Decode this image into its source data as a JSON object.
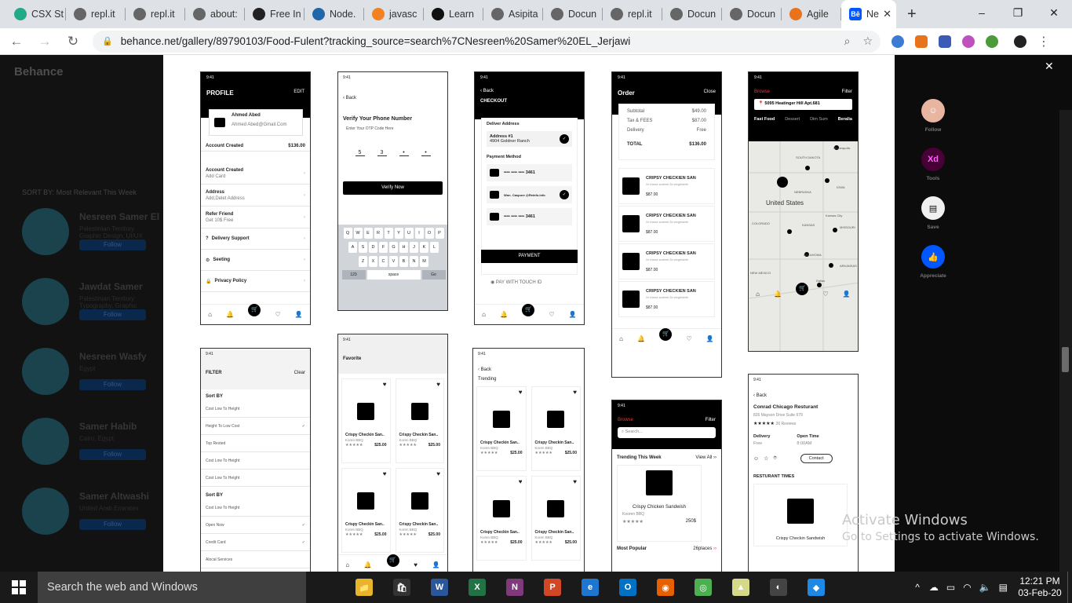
{
  "browser": {
    "tabs": [
      {
        "label": "CSX St",
        "icon": "csx-icon",
        "color": "#22aa88"
      },
      {
        "label": "repl.it",
        "icon": "repl-icon",
        "color": "#666666"
      },
      {
        "label": "repl.it",
        "icon": "repl-icon",
        "color": "#666666"
      },
      {
        "label": "about:",
        "icon": "globe-icon",
        "color": "#666666"
      },
      {
        "label": "Free In",
        "icon": "braces-icon",
        "color": "#222222"
      },
      {
        "label": "Node.",
        "icon": "node-icon",
        "color": "#2266aa"
      },
      {
        "label": "javasc",
        "icon": "stackoverflow-icon",
        "color": "#f48024"
      },
      {
        "label": "Learn",
        "icon": "learn-icon",
        "color": "#111111"
      },
      {
        "label": "Asipita",
        "icon": "globe-icon",
        "color": "#666666"
      },
      {
        "label": "Docun",
        "icon": "globe-icon",
        "color": "#666666"
      },
      {
        "label": "repl.it",
        "icon": "repl-icon",
        "color": "#666666"
      },
      {
        "label": "Docun",
        "icon": "globe-icon",
        "color": "#666666"
      },
      {
        "label": "Docun",
        "icon": "globe-icon",
        "color": "#666666"
      },
      {
        "label": "Agile",
        "icon": "agile-icon",
        "color": "#e8731a"
      }
    ],
    "active_tab": {
      "label": "Ne",
      "icon_text": "Bē"
    },
    "new_tab": "+",
    "window_controls": {
      "minimize": "–",
      "maximize": "❐",
      "close": "✕"
    },
    "url": "behance.net/gallery/89790103/Food-Fulent?tracking_source=search%7CNesreen%20Samer%20EL_Jerjawi"
  },
  "behance": {
    "logo": "Behance",
    "sort_label": "SORT BY:  Most Relevant This Week",
    "profiles": [
      {
        "name": "Nesreen Samer El",
        "sub": "Palestinian Territory\nGraphic Design, UI/UX",
        "follow": "Follow"
      },
      {
        "name": "Jawdat Samer",
        "sub": "Palestinian Territory\nTypography, Graphic Design",
        "follow": "Follow"
      },
      {
        "name": "Nesreen Wasfy",
        "sub": "Egypt",
        "follow": "Follow"
      },
      {
        "name": "Samer Habib",
        "sub": "Cairo, Egypt",
        "follow": "Follow"
      },
      {
        "name": "Samer Altwashi",
        "sub": "United Arab Emirates",
        "follow": "Follow"
      }
    ],
    "side_actions": [
      {
        "label": "Follow",
        "icon": "avatar-icon"
      },
      {
        "label": "Tools",
        "icon": "xd-icon"
      },
      {
        "label": "Save",
        "icon": "save-icon"
      },
      {
        "label": "Appreciate",
        "icon": "thumbs-up-icon"
      }
    ]
  },
  "screens": {
    "status_time": "9:41",
    "profile": {
      "title": "PROFILE",
      "edit": "EDIT",
      "name": "Ahmed Abed",
      "email": "Ahmed Abed@Gmail.Com",
      "account_created": "Account Created",
      "amount": "$136.00",
      "rows": [
        {
          "t": "Account Created",
          "s": "Add Card"
        },
        {
          "t": "Address",
          "s": "Add,Delet Address"
        },
        {
          "t": "Refer Friend",
          "s": "Get 10$ Free"
        },
        {
          "t": "Delivery Support",
          "s": ""
        },
        {
          "t": "Seeting",
          "s": ""
        },
        {
          "t": "Privacy Policy",
          "s": ""
        }
      ]
    },
    "verify": {
      "back": "Back",
      "title": "Verify Your Phone Number",
      "sub": "Enter Your OTP Code Here",
      "digits": [
        "5",
        "3",
        "•",
        "•"
      ],
      "button": "Verify Now",
      "keys1": [
        "Q",
        "W",
        "E",
        "R",
        "T",
        "Y",
        "U",
        "I",
        "O",
        "P"
      ],
      "keys2": [
        "A",
        "S",
        "D",
        "F",
        "G",
        "H",
        "J",
        "K",
        "L"
      ],
      "keys3": [
        "Z",
        "X",
        "C",
        "V",
        "B",
        "N",
        "M"
      ],
      "k123": "123",
      "space": "space",
      "go": "Go"
    },
    "checkout": {
      "back": "Back",
      "title": "CHECKOUT",
      "deliver": "Deliver Address",
      "address_label": "Address #1",
      "address": "4904 Goldner Ranch",
      "payment": "Payment Method",
      "cards": [
        "•••• •••• •••• 3461",
        "Won. Caspure @Reinfo.info",
        "•••• •••• •••• 3461"
      ],
      "button": "PAYMENT",
      "touch": "PAY WITH TOUCH ID"
    },
    "order": {
      "title": "Order",
      "close": "Close",
      "lines": [
        [
          "Subtotal",
          "$49.00"
        ],
        [
          "Tax & FEES",
          "$87.00"
        ],
        [
          "Delivery",
          "Free"
        ]
      ],
      "total_label": "TOTAL",
      "total": "$136.00",
      "items": [
        {
          "name": "CRIPSY CHECKIEN SAN",
          "desc": "2x thana scahmi,3x wegetable.",
          "price": "$87.00"
        },
        {
          "name": "CRIPSY CHECKIEN SAN",
          "desc": "2x thana scahmi,3x wegetable.",
          "price": "$87.00"
        },
        {
          "name": "CRIPSY CHECKIEN SAN",
          "desc": "2x thana scahmi,3x wegetable.",
          "price": "$87.00"
        },
        {
          "name": "CRIPSY CHECKIEN SAN",
          "desc": "2x thana scahmi,3x wegetable.",
          "price": "$87.00"
        }
      ]
    },
    "map": {
      "browse": "Browse",
      "filter": "Filter",
      "address": "5095 Heatinger Hill Apt.681",
      "tabs": [
        "Fast Food",
        "Dessert",
        "Dim Sum",
        "Beralia"
      ],
      "labels": [
        "SOUTH DAKOTA",
        "NEBRASKA",
        "IOWA",
        "United States",
        "KANSAS",
        "COLORADO",
        "Kansas City",
        "MISSOURI",
        "OKLAHOMA",
        "ARKANSAS",
        "NEW MEXICO",
        "Dallas",
        "Minneapolis"
      ]
    },
    "filter": {
      "title": "FILTER",
      "clear": "Clear",
      "sort1": "Sort BY",
      "opts1": [
        "Cost Low To Height",
        "Height To Low Cost",
        "Top Rested",
        "Cost Low To Height",
        "Cost Low To Height"
      ],
      "sort2": "Sort BY",
      "opts2": [
        "Cost Low To Height",
        "Open Now",
        "Credit Card",
        "Alocal Services"
      ]
    },
    "favorite": {
      "title": "Favorite",
      "item_name": "Crispy Checkin San..",
      "item_sub": "Koren BBQ",
      "price": "$25.00"
    },
    "trending": {
      "back": "Back",
      "title": "Trending",
      "item_name": "Crispy Checkin San..",
      "item_sub": "Koren BBQ",
      "price": "$25.00"
    },
    "browse": {
      "browse": "Browse",
      "filter": "Filter",
      "search": "Search...",
      "trending": "Trending This Week",
      "view_all": "View All",
      "item": "Crispy Chicken Sandwish",
      "item_sub": "Kooren BBQ",
      "price": "250$",
      "most_popular": "Most Popular",
      "places": "26places"
    },
    "restaurant": {
      "back": "Back",
      "name": "Conrad Chicago Resturant",
      "address": "826 Mayson Drive Suite 679",
      "reviews": "26 Reviews",
      "delivery": "Delivery",
      "delivery_v": "Free",
      "open": "Open Time",
      "open_v": "8:00AM",
      "contact": "Contact",
      "times": "RESTURANT TIMES",
      "item": "Crispy Checkin Sandwish"
    }
  },
  "watermark": {
    "line1": "Activate Windows",
    "line2": "Go to Settings to activate Windows."
  },
  "taskbar": {
    "search": "Search the web and Windows",
    "apps": [
      {
        "name": "file-explorer",
        "text": "📁",
        "color": "#e8b52a"
      },
      {
        "name": "store",
        "text": "🛍",
        "color": "#333333"
      },
      {
        "name": "word",
        "text": "W",
        "color": "#2b579a"
      },
      {
        "name": "excel",
        "text": "X",
        "color": "#217346"
      },
      {
        "name": "onenote",
        "text": "N",
        "color": "#80397b"
      },
      {
        "name": "powerpoint",
        "text": "P",
        "color": "#d24726"
      },
      {
        "name": "edge",
        "text": "e",
        "color": "#1e76d0"
      },
      {
        "name": "outlook",
        "text": "O",
        "color": "#0072c6"
      },
      {
        "name": "firefox",
        "text": "◉",
        "color": "#e66000"
      },
      {
        "name": "chrome",
        "text": "◎",
        "color": "#4caf50"
      },
      {
        "name": "maps",
        "text": "▲",
        "color": "#d6d98a"
      },
      {
        "name": "groove",
        "text": "◐",
        "color": "#444444"
      },
      {
        "name": "vscode",
        "text": "◆",
        "color": "#1e88e5"
      }
    ],
    "time": "12:21 PM",
    "date": "03-Feb-20"
  }
}
